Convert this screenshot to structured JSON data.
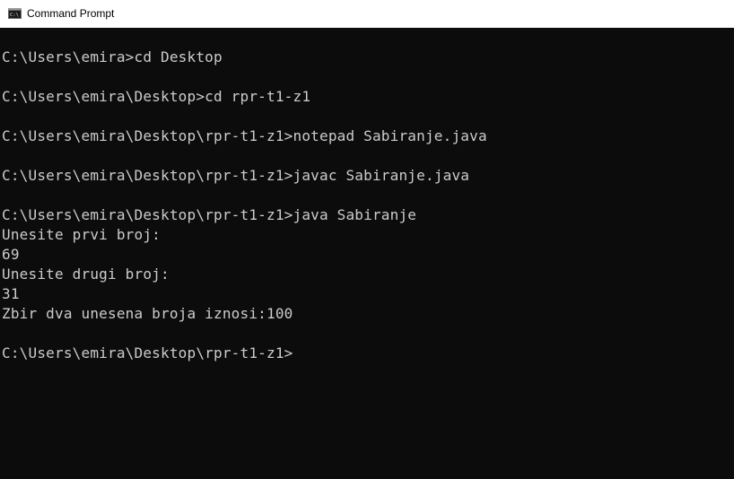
{
  "window": {
    "title": "Command Prompt"
  },
  "icons": {
    "app": "command-prompt-icon"
  },
  "colors": {
    "console_background": "#0c0c0c",
    "console_text": "#cccccc",
    "titlebar_background": "#ffffff"
  },
  "console": {
    "lines": [
      "C:\\Users\\emira>cd Desktop",
      "C:\\Users\\emira\\Desktop>cd rpr-t1-z1",
      "C:\\Users\\emira\\Desktop\\rpr-t1-z1>notepad Sabiranje.java",
      "C:\\Users\\emira\\Desktop\\rpr-t1-z1>javac Sabiranje.java",
      "C:\\Users\\emira\\Desktop\\rpr-t1-z1>java Sabiranje",
      "Unesite prvi broj:",
      "69",
      "Unesite drugi broj:",
      "31",
      "Zbir dva unesena broja iznosi:100",
      "C:\\Users\\emira\\Desktop\\rpr-t1-z1>"
    ]
  }
}
